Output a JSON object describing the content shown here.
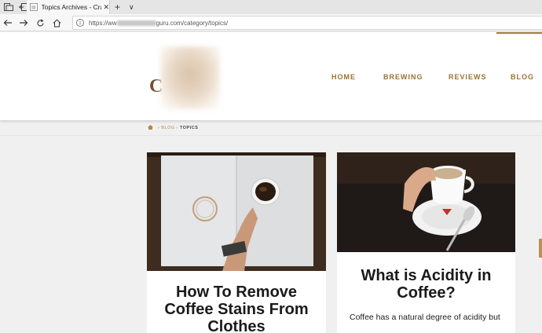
{
  "browser": {
    "tab_title": "Topics Archives - Craft C",
    "tab_close": "✕",
    "new_tab": "+",
    "tab_menu": "∨",
    "url_prefix": "https://ww",
    "url_suffix": "guru.com/category/topics/"
  },
  "site": {
    "logo_letter": "C",
    "menu": [
      "HOME",
      "BREWING",
      "REVIEWS",
      "BLOG"
    ],
    "accent_color": "#9a7333"
  },
  "breadcrumb": {
    "home_icon": "home-icon",
    "blog": "BLOG",
    "current": "TOPICS"
  },
  "posts": [
    {
      "title_line1": "How To Remove",
      "title_line2": "Coffee Stains From",
      "title_line3": "Clothes"
    },
    {
      "title_line1": "What is Acidity in",
      "title_line2": "Coffee?",
      "excerpt": "Coffee has a natural degree of acidity but"
    }
  ]
}
